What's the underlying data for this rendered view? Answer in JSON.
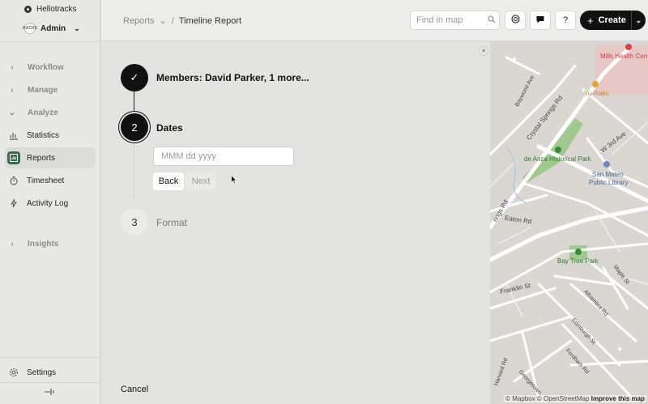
{
  "app": {
    "org_name": "Hellotracks",
    "account_label": "Admin",
    "avatar_text": "RACKS"
  },
  "sidebar": {
    "sections": [
      {
        "label": "Workflow",
        "expanded": false
      },
      {
        "label": "Manage",
        "expanded": false
      },
      {
        "label": "Analyze",
        "expanded": true
      },
      {
        "label": "Insights",
        "expanded": false
      }
    ],
    "analyze_items": [
      {
        "label": "Statistics",
        "icon": "bar-chart-icon",
        "active": false
      },
      {
        "label": "Reports",
        "icon": "report-icon",
        "active": true
      },
      {
        "label": "Timesheet",
        "icon": "timer-icon",
        "active": false
      },
      {
        "label": "Activity Log",
        "icon": "bolt-icon",
        "active": false
      }
    ],
    "settings_label": "Settings"
  },
  "topbar": {
    "breadcrumb_parent": "Reports",
    "breadcrumb_separator": "/",
    "breadcrumb_current": "Timeline Report",
    "search_placeholder": "Find in map",
    "help_label": "?",
    "create_label": "Create"
  },
  "wizard": {
    "steps": [
      {
        "number": "✓",
        "title": "Members: David Parker, 1 more...",
        "state": "done"
      },
      {
        "number": "2",
        "title": "Dates",
        "state": "active"
      },
      {
        "number": "3",
        "title": "Format",
        "state": "pending"
      }
    ],
    "date_placeholder": "MMM dd yyyy",
    "back_label": "Back",
    "next_label": "Next",
    "cancel_label": "Cancel"
  },
  "map": {
    "labels": {
      "health": "Mills Health Cen",
      "baywood": "Baywood Ave",
      "yuraku": "Yu-Raku",
      "crystal": "Crystal Springs Rd",
      "w3rd": "W 3rd Ave",
      "deanza": "de Anza Historical Park",
      "library1": "San Mateo",
      "library2": "Public Library",
      "springs": "rings Rd",
      "eaton": "Eaton Rd",
      "baytree": "Bay Tree Park",
      "maple": "Maple St",
      "franklin": "Franklin St",
      "alhambra": "Alhambra Rd",
      "edinburgh": "Edinburgh St",
      "fordham": "Fordham Rd",
      "harvard": "Harvard Rd",
      "georgetown": "Georgetown"
    },
    "attribution_mapbox": "© Mapbox",
    "attribution_osm": "© OpenStreetMap",
    "attribution_improve": "Improve this map"
  }
}
